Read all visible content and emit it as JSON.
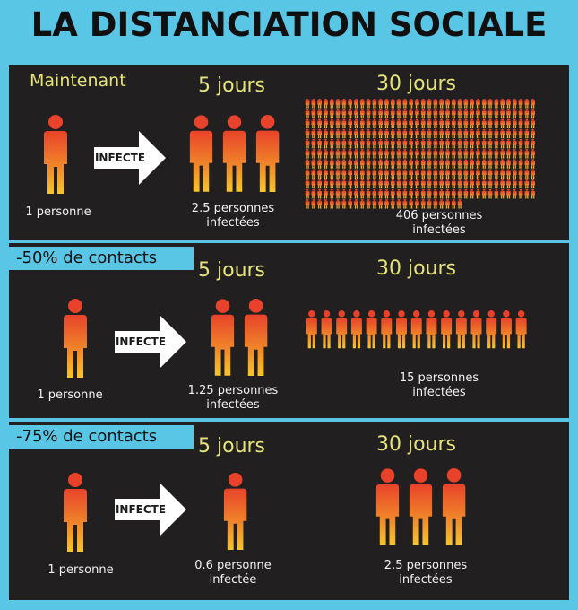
{
  "title": "LA DISTANCIATION SOCIALE",
  "colors": {
    "background": "#5ac6e6",
    "panel": "#221f20",
    "label_yellow": "#e6e37a",
    "person_top": "#e8432a",
    "person_bottom": "#f7c52c"
  },
  "arrow_label": "INFECTE",
  "rows": [
    {
      "header": "Maintenant",
      "day5_label": "5 jours",
      "day30_label": "30 jours",
      "start": "1 personne",
      "day5_text": "2.5 personnes infectées",
      "day30_text": "406 personnes infectées",
      "day5_count": 2.5,
      "day30_count": 406
    },
    {
      "header": "-50% de contacts",
      "day5_label": "5 jours",
      "day30_label": "30 jours",
      "start": "1 personne",
      "day5_text": "1.25 personnes infectées",
      "day30_text": "15 personnes infectées",
      "day5_count": 1.25,
      "day30_count": 15
    },
    {
      "header": "-75% de contacts",
      "day5_label": "5 jours",
      "day30_label": "30 jours",
      "start": "1 personne",
      "day5_text": "0.6 personne infectée",
      "day30_text": "2.5 personnes infectées",
      "day5_count": 0.6,
      "day30_count": 2.5
    }
  ]
}
